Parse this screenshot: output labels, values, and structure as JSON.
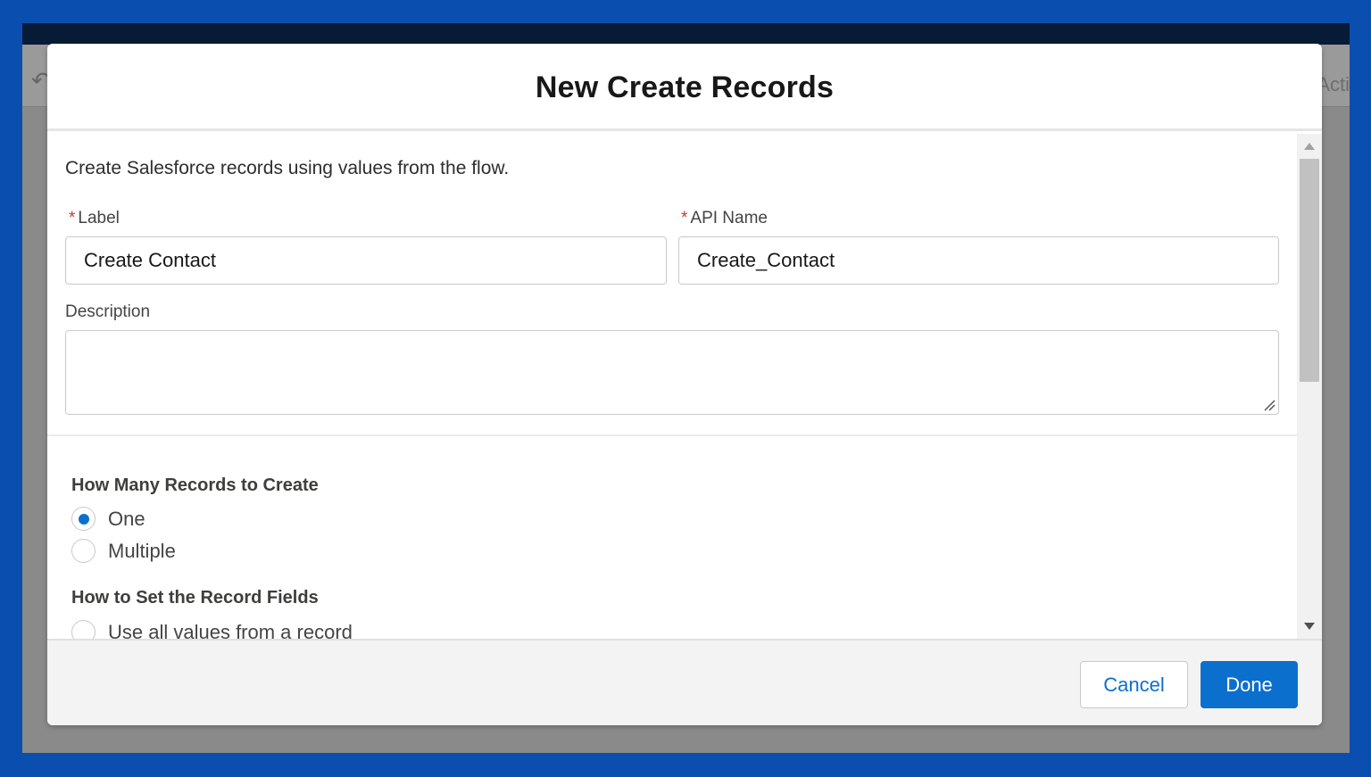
{
  "background_screen": {
    "toolbar_right_text": "Acti"
  },
  "modal": {
    "title": "New Create Records",
    "intro": "Create Salesforce records using values from the flow.",
    "fields": {
      "label": {
        "label": "Label",
        "value": "Create Contact",
        "required": true
      },
      "api_name": {
        "label": "API Name",
        "value": "Create_Contact",
        "required": true
      },
      "description": {
        "label": "Description",
        "value": ""
      }
    },
    "required_marker": "*",
    "how_many": {
      "title": "How Many Records to Create",
      "options": [
        {
          "label": "One",
          "checked": true
        },
        {
          "label": "Multiple",
          "checked": false
        }
      ]
    },
    "how_to_set": {
      "title": "How to Set the Record Fields",
      "options": [
        {
          "label": "Use all values from a record",
          "checked": false
        }
      ]
    },
    "footer": {
      "cancel_label": "Cancel",
      "done_label": "Done"
    }
  },
  "colors": {
    "brand_blue": "#0b6fce",
    "frame_blue": "#0a4fb0",
    "required_red": "#c23934"
  }
}
